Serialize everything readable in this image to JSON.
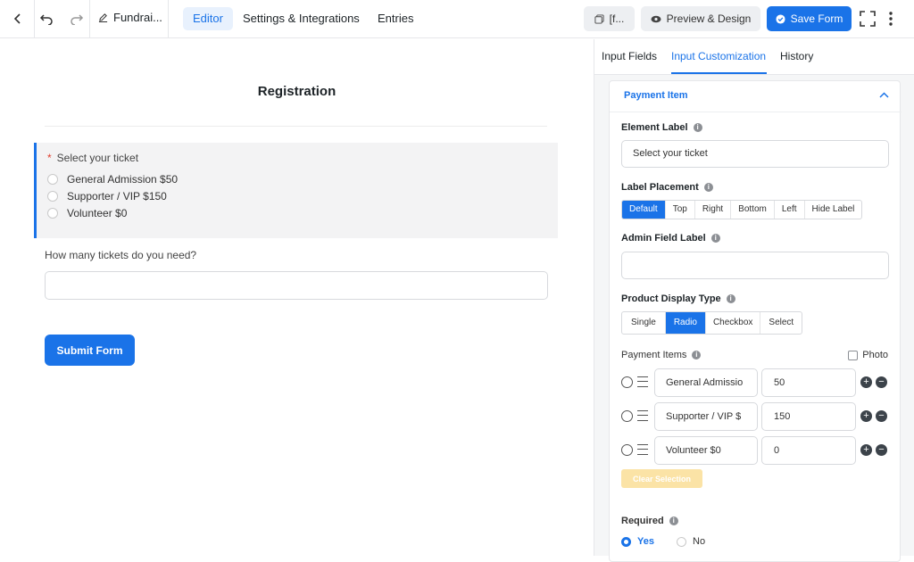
{
  "topbar": {
    "form_name": "Fundrai...",
    "tabs": [
      "Editor",
      "Settings & Integrations",
      "Entries"
    ],
    "active_tab": "Editor",
    "shortcode_label": "[f...",
    "preview_label": "Preview & Design",
    "save_label": "Save Form"
  },
  "form": {
    "title": "Registration",
    "ticket_label": "Select your ticket",
    "required_mark": "*",
    "options": [
      "General Admission $50",
      "Supporter / VIP $150",
      "Volunteer $0"
    ],
    "qty_label": "How many tickets do you need?",
    "qty_value": "",
    "submit_label": "Submit Form"
  },
  "panel": {
    "tabs": [
      "Input Fields",
      "Input Customization",
      "History"
    ],
    "active_tab": "Input Customization",
    "section_title": "Payment Item",
    "element_label_title": "Element Label",
    "element_label_value": "Select your ticket",
    "label_placement_title": "Label Placement",
    "label_placement_options": [
      "Default",
      "Top",
      "Right",
      "Bottom",
      "Left",
      "Hide Label"
    ],
    "label_placement_selected": "Default",
    "admin_field_label_title": "Admin Field Label",
    "admin_field_label_value": "",
    "product_display_title": "Product Display Type",
    "product_display_options": [
      "Single",
      "Radio",
      "Checkbox",
      "Select"
    ],
    "product_display_selected": "Radio",
    "payment_items_title": "Payment Items",
    "photo_label": "Photo",
    "payment_items": [
      {
        "name": "General Admissio",
        "value": "50"
      },
      {
        "name": "Supporter / VIP $",
        "value": "150"
      },
      {
        "name": "Volunteer $0",
        "value": "0"
      }
    ],
    "clear_selection_label": "Clear Selection",
    "required_title": "Required",
    "required_options": [
      "Yes",
      "No"
    ],
    "required_selected": "Yes"
  },
  "colors": {
    "accent": "#1a73e8",
    "required_mark": "#e03e2d",
    "clear_btn": "#fbe3a6"
  }
}
